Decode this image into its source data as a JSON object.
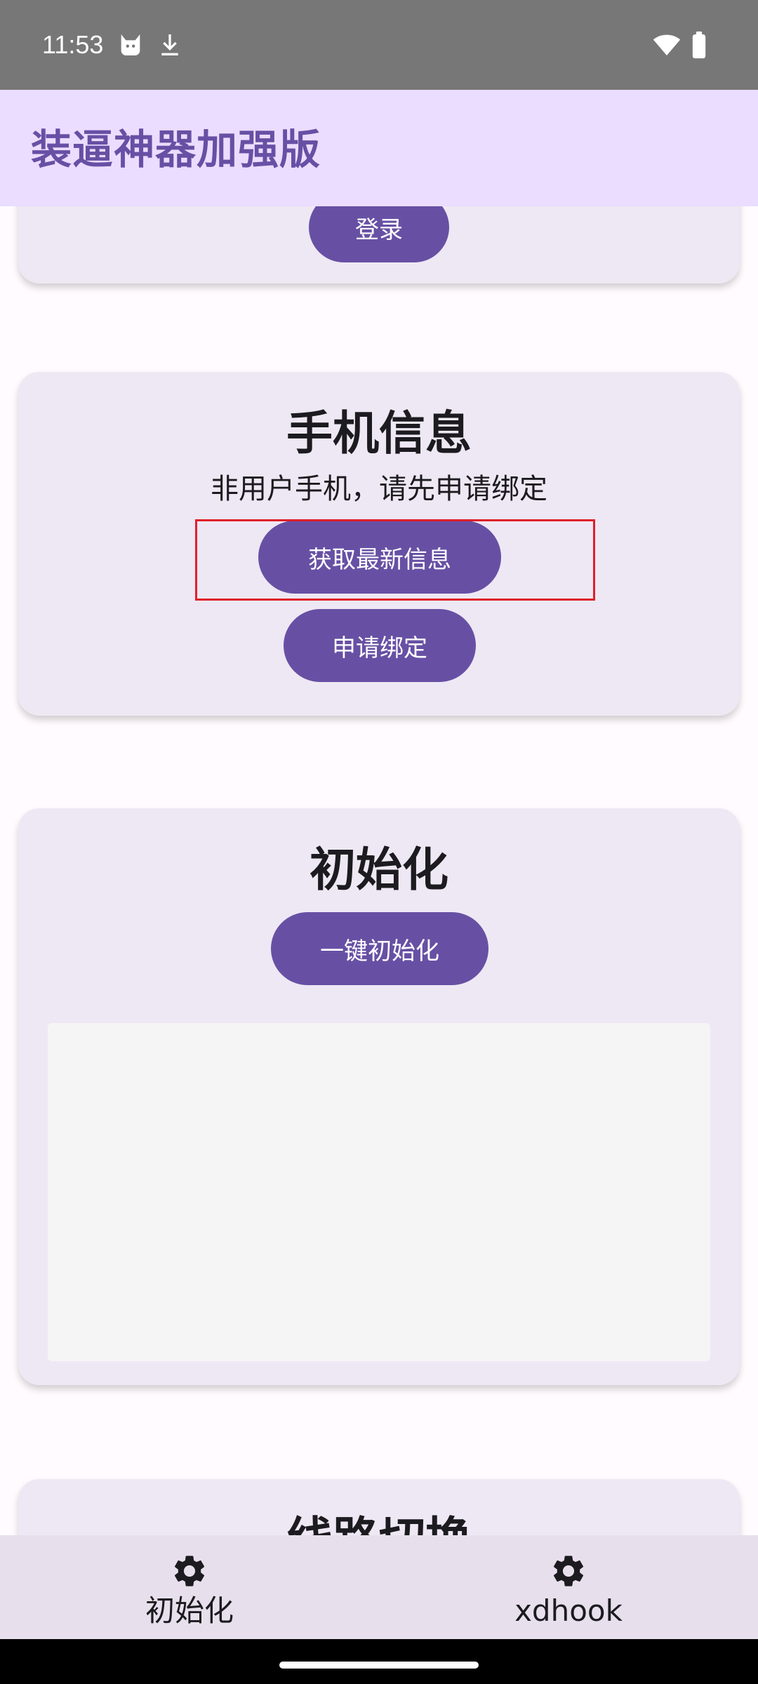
{
  "status_bar": {
    "time": "11:53",
    "icons": [
      "cat-icon",
      "download-icon",
      "wifi-icon",
      "battery-icon"
    ]
  },
  "app_bar": {
    "title": "装逼神器加强版"
  },
  "login_card": {
    "login_label": "登录"
  },
  "phone_card": {
    "title": "手机信息",
    "status_text": "非用户手机，请先申请绑定",
    "fetch_label": "获取最新信息",
    "bind_label": "申请绑定"
  },
  "init_card": {
    "title": "初始化",
    "init_label": "一键初始化"
  },
  "route_card": {
    "title": "线路切换"
  },
  "bottom_nav": {
    "items": [
      {
        "label": "初始化",
        "icon": "gear-icon"
      },
      {
        "label": "xdhook",
        "icon": "gear-icon"
      }
    ]
  },
  "colors": {
    "primary": "#6750A4",
    "app_bar_bg": "#EADDFF",
    "card_bg": "#EEE8F4",
    "highlight": "#E0202A",
    "nav_bg": "#E7E0EC"
  }
}
